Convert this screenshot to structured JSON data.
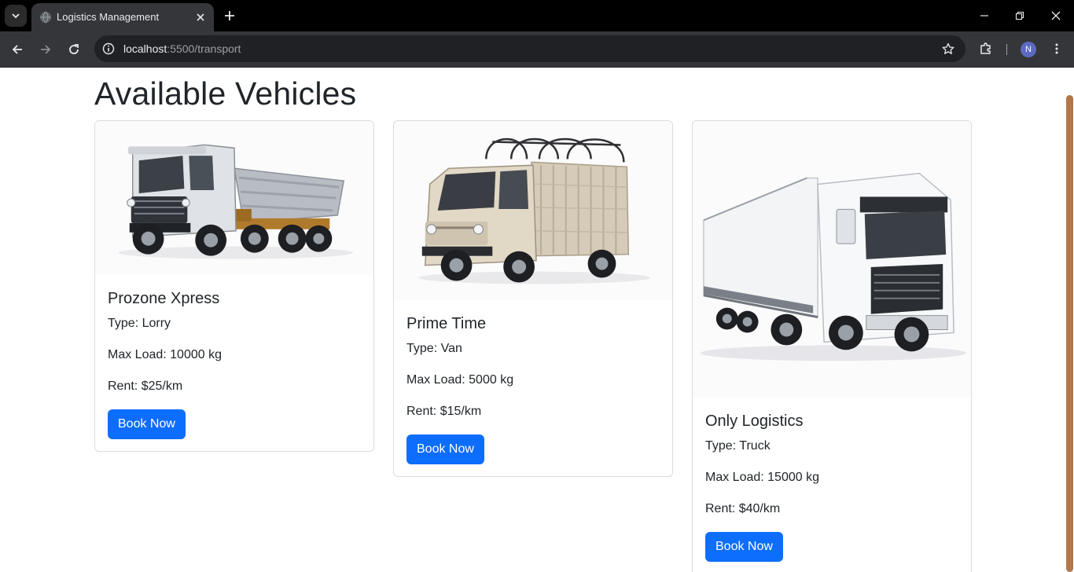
{
  "browser": {
    "tab_title": "Logistics Management",
    "url_host": "localhost",
    "url_path": ":5500/transport",
    "profile_initial": "N",
    "scrollbar_color": "#b4764b"
  },
  "page": {
    "heading": "Available Vehicles"
  },
  "vehicles": [
    {
      "name": "Prozone Xpress",
      "type": "Type: Lorry",
      "max_load": "Max Load: 10000 kg",
      "rent": "Rent: $25/km",
      "button": "Book Now",
      "image_icon": "dump-truck-image"
    },
    {
      "name": "Prime Time",
      "type": "Type: Van",
      "max_load": "Max Load: 5000 kg",
      "rent": "Rent: $15/km",
      "button": "Book Now",
      "image_icon": "mini-truck-image"
    },
    {
      "name": "Only Logistics",
      "type": "Type: Truck",
      "max_load": "Max Load: 15000 kg",
      "rent": "Rent: $40/km",
      "button": "Book Now",
      "image_icon": "semi-truck-image"
    }
  ],
  "colors": {
    "primary_button": "#0d6efd",
    "text": "#212529"
  }
}
